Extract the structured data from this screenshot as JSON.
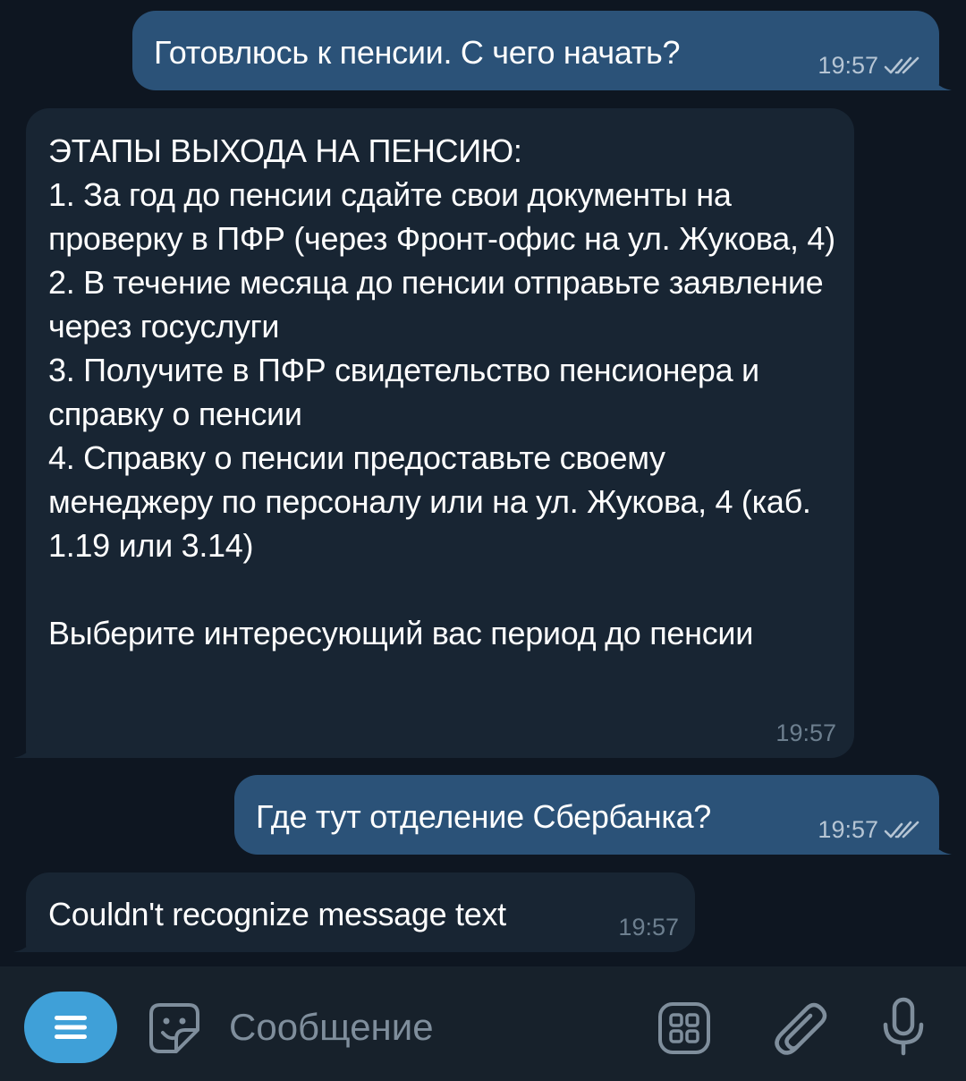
{
  "messages": [
    {
      "direction": "outgoing",
      "text": "Готовлюсь к пенсии. С чего начать?",
      "time": "19:57",
      "status": "read"
    },
    {
      "direction": "incoming",
      "text": "ЭТАПЫ ВЫХОДА НА ПЕНСИЮ:\n1. За год до пенсии сдайте свои документы на проверку в ПФР (через Фронт-офис на ул. Жукова, 4)\n2. В течение месяца до пенсии отправьте заявление через госуслуги\n3. Получите в ПФР свидетельство пенсионера и справку о пенсии\n4. Справку о пенсии предоставьте своему менеджеру по персоналу или на ул. Жукова, 4 (каб. 1.19 или 3.14)\n\nВыберите интересующий вас период до пенсии",
      "time": "19:57"
    },
    {
      "direction": "outgoing",
      "text": "Где тут отделение Сбербанка?",
      "time": "19:57",
      "status": "read"
    },
    {
      "direction": "incoming",
      "text": "Couldn't recognize message text",
      "time": "19:57"
    }
  ],
  "input": {
    "placeholder": "Сообщение",
    "value": ""
  },
  "icons": {
    "menu": "menu-icon",
    "sticker": "sticker-icon",
    "keyboard": "bot-keyboard-icon",
    "attach": "paperclip-icon",
    "mic": "microphone-icon",
    "read": "double-check-icon"
  },
  "colors": {
    "background": "#0e1621",
    "outgoing_bubble": "#2b5278",
    "incoming_bubble": "#182533",
    "input_bar": "#17212b",
    "accent": "#3fa0d8"
  }
}
